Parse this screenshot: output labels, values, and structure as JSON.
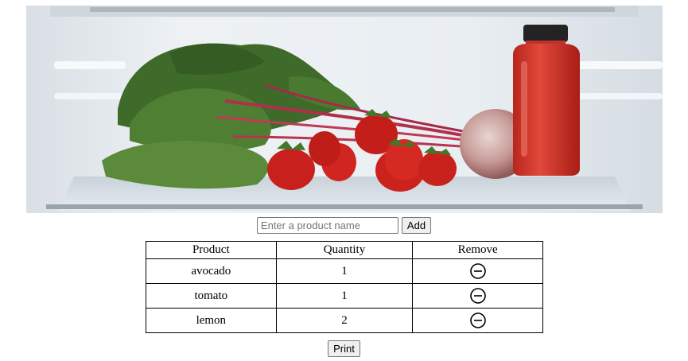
{
  "hero": {
    "image": "refrigerator shelf with strawberries, beetroot and a juice bottle"
  },
  "add_form": {
    "placeholder": "Enter a product name",
    "value": "",
    "add_label": "Add"
  },
  "table": {
    "headers": [
      "Product",
      "Quantity",
      "Remove"
    ],
    "rows": [
      {
        "product": "avocado",
        "quantity": "1",
        "remove_icon": "minus-circle-icon"
      },
      {
        "product": "tomato",
        "quantity": "1",
        "remove_icon": "minus-circle-icon"
      },
      {
        "product": "lemon",
        "quantity": "2",
        "remove_icon": "minus-circle-icon"
      }
    ]
  },
  "print_label": "Print"
}
